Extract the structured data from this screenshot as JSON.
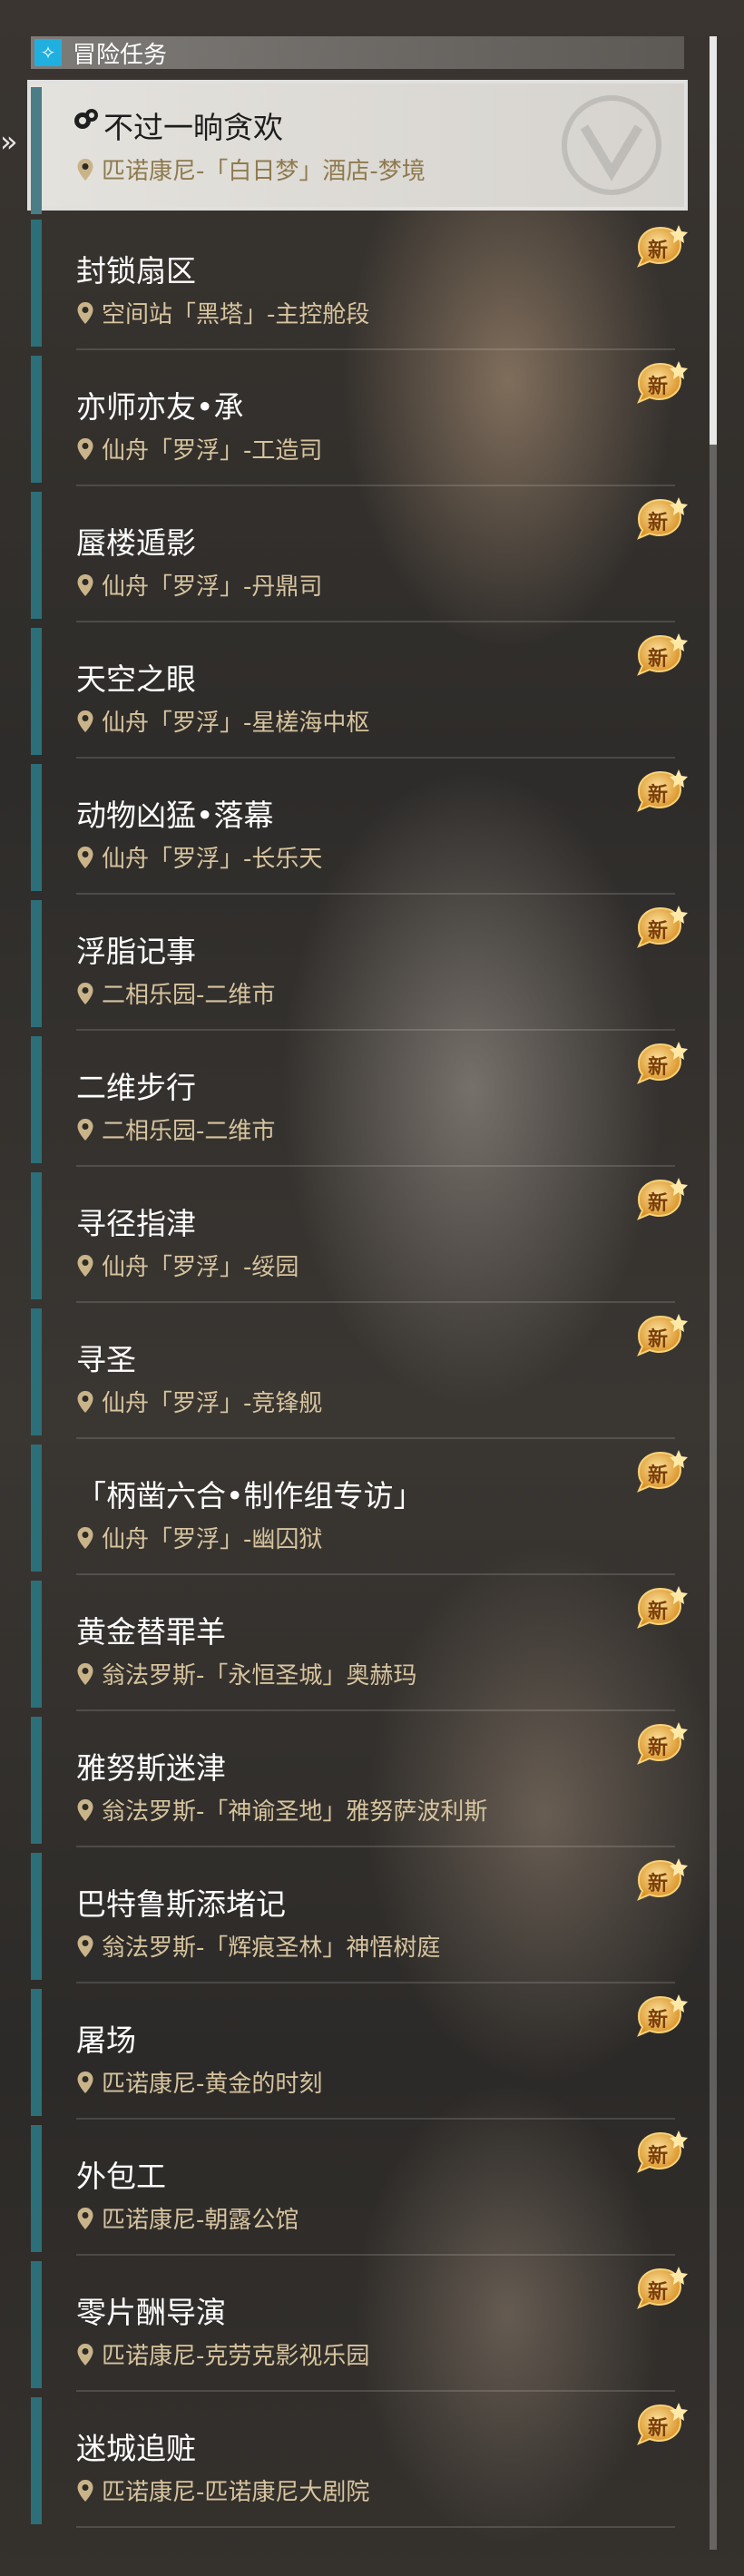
{
  "header": {
    "title": "冒险任务",
    "icon": "diamond-sparkle-icon"
  },
  "colors": {
    "accent_bar": "#2c6f78",
    "location_text": "#d7c49e",
    "badge_gold": "#e2a83a",
    "header_icon_bg": "#1fb0e0"
  },
  "badge_label": "新",
  "quests": [
    {
      "name": "不过一晌贪欢",
      "location": "匹诺康尼-「白日梦」酒店-梦境",
      "active": true
    },
    {
      "name": "封锁扇区",
      "location": "空间站「黑塔」-主控舱段"
    },
    {
      "name": "亦师亦友•承",
      "location": "仙舟「罗浮」-工造司"
    },
    {
      "name": "蜃楼遁影",
      "location": "仙舟「罗浮」-丹鼎司"
    },
    {
      "name": "天空之眼",
      "location": "仙舟「罗浮」-星槎海中枢"
    },
    {
      "name": "动物凶猛•落幕",
      "location": "仙舟「罗浮」-长乐天"
    },
    {
      "name": "浮脂记事",
      "location": "二相乐园-二维市"
    },
    {
      "name": "二维步行",
      "location": "二相乐园-二维市"
    },
    {
      "name": "寻径指津",
      "location": "仙舟「罗浮」-绥园"
    },
    {
      "name": "寻圣",
      "location": "仙舟「罗浮」-竞锋舰"
    },
    {
      "name": "「柄凿六合•制作组专访」",
      "location": "仙舟「罗浮」-幽囚狱"
    },
    {
      "name": "黄金替罪羊",
      "location": "翁法罗斯-「永恒圣城」奥赫玛"
    },
    {
      "name": "雅努斯迷津",
      "location": "翁法罗斯-「神谕圣地」雅努萨波利斯"
    },
    {
      "name": "巴特鲁斯添堵记",
      "location": "翁法罗斯-「辉痕圣林」神悟树庭"
    },
    {
      "name": "屠场",
      "location": "匹诺康尼-黄金的时刻"
    },
    {
      "name": "外包工",
      "location": "匹诺康尼-朝露公馆"
    },
    {
      "name": "零片酬导演",
      "location": "匹诺康尼-克劳克影视乐园"
    },
    {
      "name": "迷城追赃",
      "location": "匹诺康尼-匹诺康尼大剧院"
    }
  ]
}
